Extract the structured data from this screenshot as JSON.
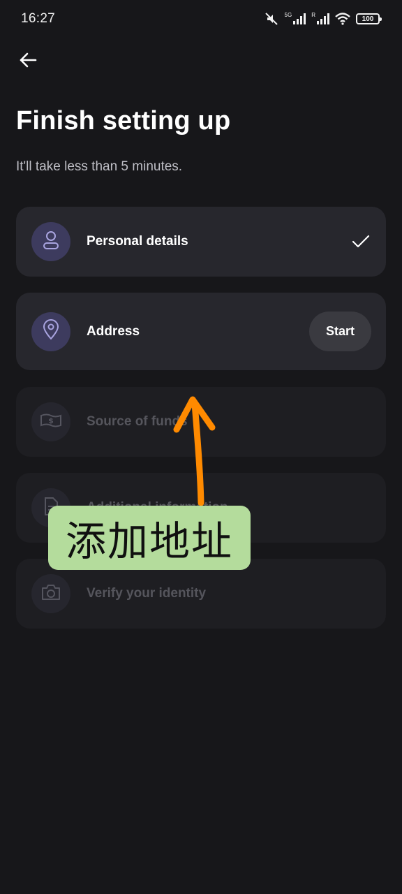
{
  "status_bar": {
    "time": "16:27",
    "signal_1_label": "5G",
    "signal_2_label": "R",
    "battery": "100"
  },
  "header": {
    "back_icon": "arrow-left-icon",
    "title": "Finish setting up",
    "subtitle": "It'll take less than 5 minutes."
  },
  "steps": [
    {
      "label": "Personal details",
      "icon": "person-icon",
      "state": "completed",
      "trailing": "check-icon"
    },
    {
      "label": "Address",
      "icon": "location-pin-icon",
      "state": "active",
      "action_label": "Start"
    },
    {
      "label": "Source of funds",
      "icon": "banknote-icon",
      "state": "disabled"
    },
    {
      "label": "Additional information",
      "icon": "document-icon",
      "state": "disabled"
    },
    {
      "label": "Verify your identity",
      "icon": "camera-icon",
      "state": "disabled"
    }
  ],
  "overlay": {
    "annotation_text": "添加地址",
    "annotation_color": "#b4dc9c",
    "arrow_color": "#ff8a00"
  },
  "colors": {
    "background": "#17171a",
    "card": "#27272d",
    "icon_circle": "#3d3b5e",
    "icon_stroke": "#a9a4e0"
  }
}
